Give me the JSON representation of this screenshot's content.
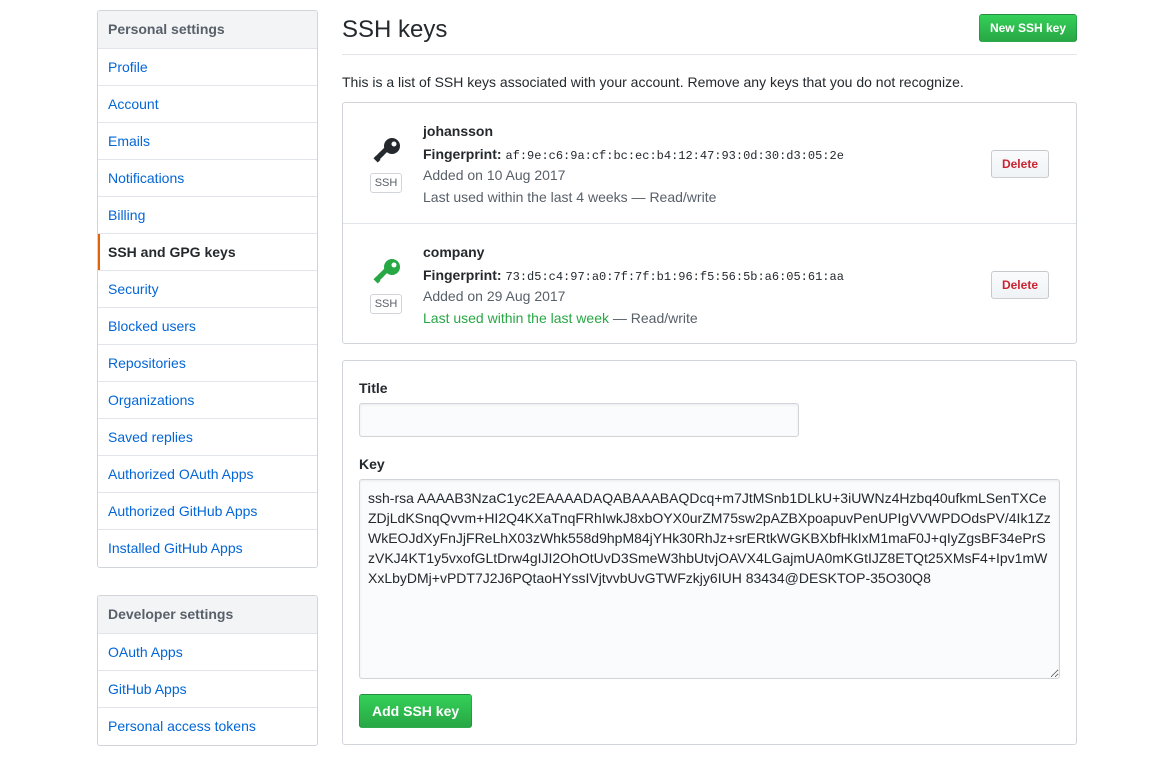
{
  "sidebar": {
    "personal_heading": "Personal settings",
    "personal_items": [
      {
        "label": "Profile"
      },
      {
        "label": "Account"
      },
      {
        "label": "Emails"
      },
      {
        "label": "Notifications"
      },
      {
        "label": "Billing"
      },
      {
        "label": "SSH and GPG keys",
        "selected": true
      },
      {
        "label": "Security"
      },
      {
        "label": "Blocked users"
      },
      {
        "label": "Repositories"
      },
      {
        "label": "Organizations"
      },
      {
        "label": "Saved replies"
      },
      {
        "label": "Authorized OAuth Apps"
      },
      {
        "label": "Authorized GitHub Apps"
      },
      {
        "label": "Installed GitHub Apps"
      }
    ],
    "developer_heading": "Developer settings",
    "developer_items": [
      {
        "label": "OAuth Apps"
      },
      {
        "label": "GitHub Apps"
      },
      {
        "label": "Personal access tokens"
      }
    ]
  },
  "main": {
    "title": "SSH keys",
    "new_key_button": "New SSH key",
    "intro": "This is a list of SSH keys associated with your account. Remove any keys that you do not recognize.",
    "keys": [
      {
        "name": "johansson",
        "fingerprint_label": "Fingerprint:",
        "fingerprint": "af:9e:c6:9a:cf:bc:ec:b4:12:47:93:0d:30:d3:05:2e",
        "added": "Added on 10 Aug 2017",
        "last_used": "Last used within the last 4 weeks",
        "access": " — Read/write",
        "badge": "SSH",
        "delete_label": "Delete",
        "icon": "key-icon",
        "icon_color": "#24292e"
      },
      {
        "name": "company",
        "fingerprint_label": "Fingerprint:",
        "fingerprint": "73:d5:c4:97:a0:7f:7f:b1:96:f5:56:5b:a6:05:61:aa",
        "added": "Added on 29 Aug 2017",
        "last_used": "Last used within the last week",
        "access": " — Read/write",
        "badge": "SSH",
        "delete_label": "Delete",
        "icon": "key-icon",
        "icon_color": "#28a745"
      }
    ],
    "form": {
      "title_label": "Title",
      "title_value": "",
      "key_label": "Key",
      "key_value": "ssh-rsa AAAAB3NzaC1yc2EAAAADAQABAAABAQDcq+m7JtMSnb1DLkU+3iUWNz4Hzbq40ufkmLSenTXCeZDjLdKSnqQvvm+HI2Q4KXaTnqFRhIwkJ8xbOYX0urZM75sw2pAZBXpoapuvPenUPIgVVWPDOdsPV/4Ik1ZzWkEOJdXyFnJjFReLhX03zWhk558d9hpM84jYHk30RhJz+srERtkWGKBXbfHkIxM1maF0J+qIyZgsBF34ePrSzVKJ4KT1y5vxofGLtDrw4gIJI2OhOtUvD3SmeW3hbUtvjOAVX4LGajmUA0mKGtIJZ8ETQt25XMsF4+Ipv1mWXxLbyDMj+vPDT7J2J6PQtaoHYssIVjtvvbUvGTWFzkjy6IUH 83434@DESKTOP-35O30Q8",
      "submit_label": "Add SSH key"
    }
  },
  "colors": {
    "accent_green": "#28a745",
    "link_blue": "#0366d6",
    "danger_red": "#cb2431",
    "selected_marker": "#e36209"
  }
}
